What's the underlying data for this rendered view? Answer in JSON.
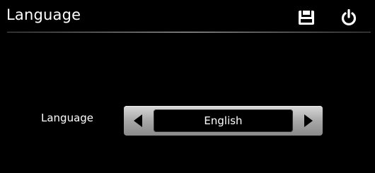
{
  "header": {
    "title": "Language",
    "save_icon": "floppy-disk-icon",
    "power_icon": "power-icon"
  },
  "setting": {
    "label": "Language",
    "value": "English",
    "prev_icon": "triangle-left-icon",
    "next_icon": "triangle-right-icon"
  },
  "colors": {
    "background": "#000000",
    "text": "#ffffff",
    "selector_gray": "#a8a8a8"
  }
}
